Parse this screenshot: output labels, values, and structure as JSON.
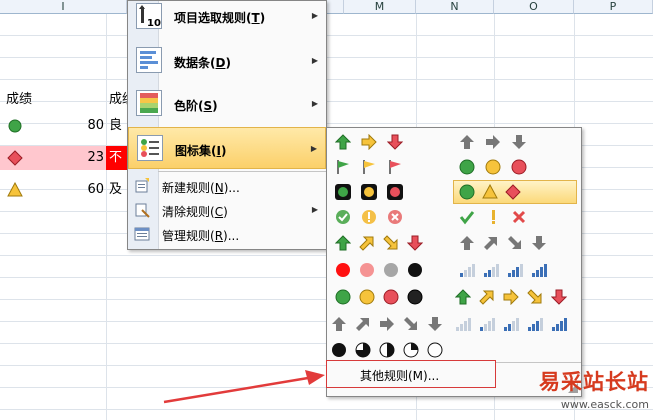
{
  "columns": {
    "left_header": "I",
    "right_headers": [
      "M",
      "N",
      "O",
      "P"
    ]
  },
  "sheet": {
    "header_cell": "成绩",
    "header_cell2": "成绩",
    "rows": [
      {
        "value": "80",
        "trail": "良",
        "icon": "green-circle"
      },
      {
        "value": "23",
        "trail": "不",
        "icon": "red-diamond"
      },
      {
        "value": "60",
        "trail": "及",
        "icon": "yellow-triangle"
      }
    ]
  },
  "menu": {
    "items": [
      {
        "label": "项目选取规则",
        "key": "T",
        "suffix": ")",
        "submenu": true
      },
      {
        "label": "数据条",
        "key": "D",
        "suffix": ")",
        "submenu": true
      },
      {
        "label": "色阶",
        "key": "S",
        "suffix": ")",
        "submenu": true
      },
      {
        "label": "图标集",
        "key": "I",
        "suffix": ")",
        "submenu": true,
        "active": true
      }
    ],
    "small_items": [
      {
        "label": "新建规则",
        "key": "N",
        "suffix": ")...",
        "submenu": false
      },
      {
        "label": "清除规则",
        "key": "C",
        "suffix": ")",
        "submenu": true
      },
      {
        "label": "管理规则",
        "key": "R",
        "suffix": ")...",
        "submenu": false
      }
    ]
  },
  "icon_sets_menu": {
    "more_rules_label": "其他规则(M)...",
    "selected_set": "3-shapes"
  },
  "watermark": {
    "brand": "易采站长站",
    "url": "www.easck.com"
  },
  "colors": {
    "highlight": "#fbd97a",
    "row_red": "#ffc7ce",
    "cell_red": "#ff0000",
    "frame": "#d73a3a"
  }
}
